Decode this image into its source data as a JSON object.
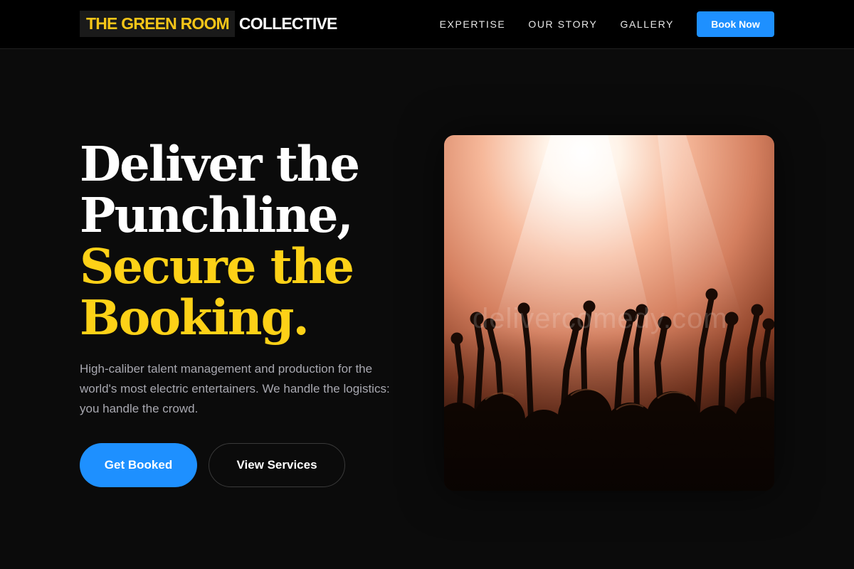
{
  "header": {
    "logo_highlight": "THE GREEN ROOM",
    "logo_rest": "COLLECTIVE",
    "nav": [
      {
        "label": "EXPERTISE"
      },
      {
        "label": "OUR STORY"
      },
      {
        "label": "GALLERY"
      }
    ],
    "cta_label": "Book Now"
  },
  "hero": {
    "title_line1": "Deliver the",
    "title_line2": "Punchline,",
    "title_line3": "Secure the",
    "title_line4": "Booking.",
    "description": "High-caliber talent management and production for the world's most electric entertainers. We handle the logistics: you handle the crowd.",
    "primary_button": "Get Booked",
    "secondary_button": "View Services",
    "image_watermark": "delivercomedy.com"
  },
  "colors": {
    "background": "#0b0b0b",
    "header_bg": "#000000",
    "accent_yellow": "#fdd117",
    "accent_blue": "#1e90ff",
    "muted_text": "#a8a8b0"
  },
  "icons": {
    "hero_image": "concert-crowd-photo"
  }
}
